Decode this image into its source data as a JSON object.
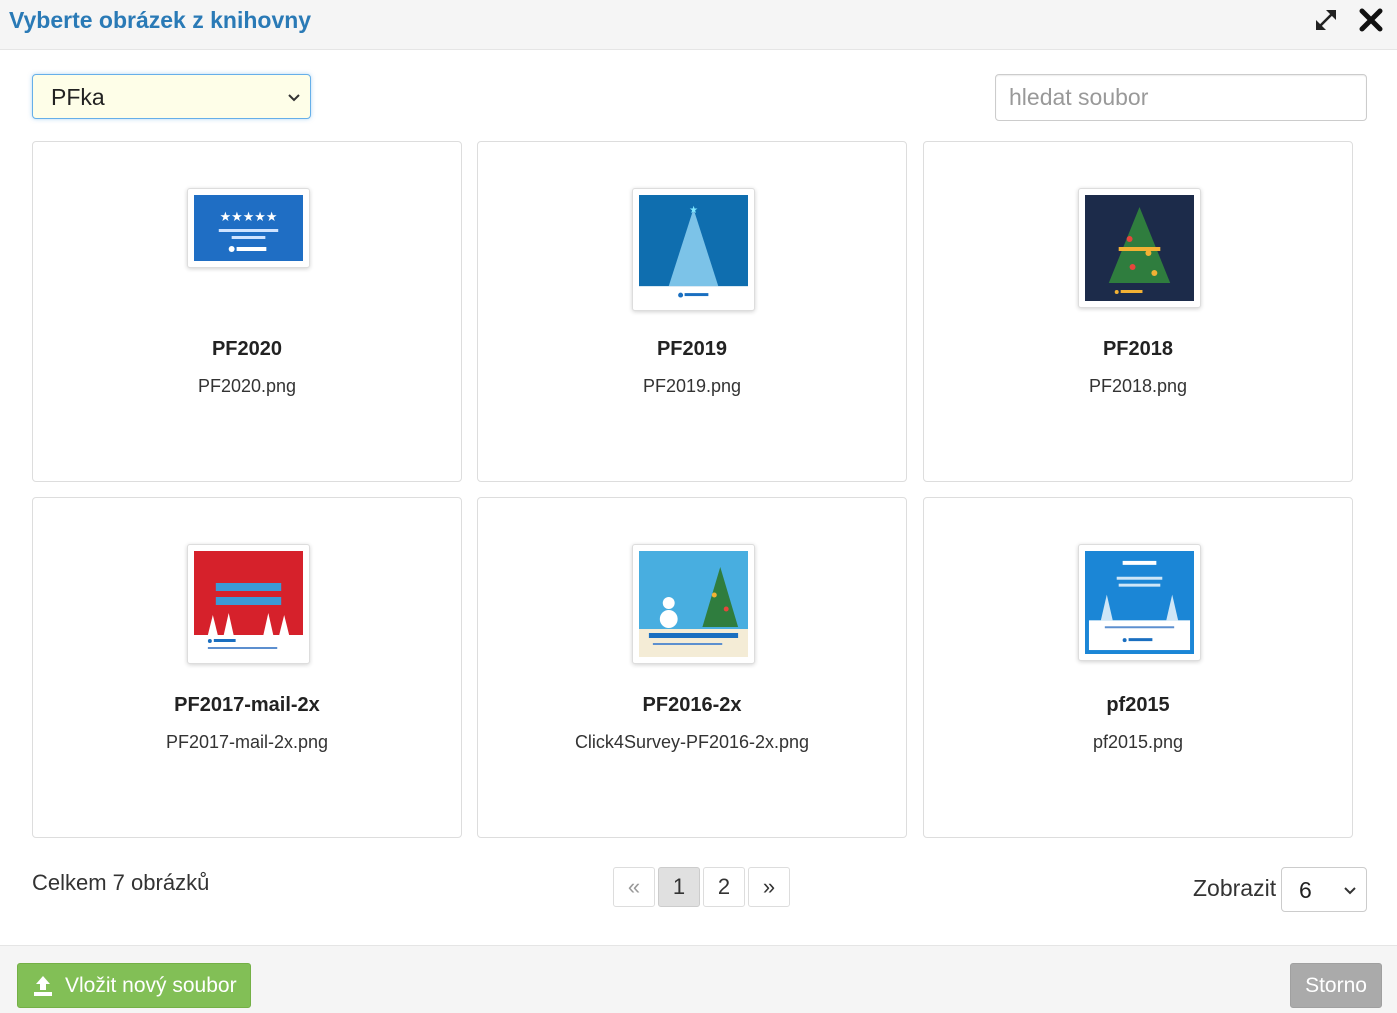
{
  "header": {
    "title": "Vyberte obrázek z knihovny"
  },
  "folder_select": {
    "value": "PFka"
  },
  "search": {
    "placeholder": "hledat soubor"
  },
  "images": [
    {
      "name": "PF2020",
      "file": "PF2020.png"
    },
    {
      "name": "PF2019",
      "file": "PF2019.png"
    },
    {
      "name": "PF2018",
      "file": "PF2018.png"
    },
    {
      "name": "PF2017-mail-2x",
      "file": "PF2017-mail-2x.png"
    },
    {
      "name": "PF2016-2x",
      "file": "Click4Survey-PF2016-2x.png"
    },
    {
      "name": "pf2015",
      "file": "pf2015.png"
    }
  ],
  "summary": {
    "total": "Celkem 7 obrázků"
  },
  "pagination": {
    "prev": "«",
    "pages": [
      "1",
      "2"
    ],
    "next": "»",
    "current": "1"
  },
  "per_page": {
    "label": "Zobrazit",
    "value": "6"
  },
  "footer": {
    "upload_label": "Vložit nový soubor",
    "cancel_label": "Storno"
  },
  "colors": {
    "title": "#2a7ab6",
    "upload": "#82bf56",
    "cancel": "#aaaaaa"
  }
}
